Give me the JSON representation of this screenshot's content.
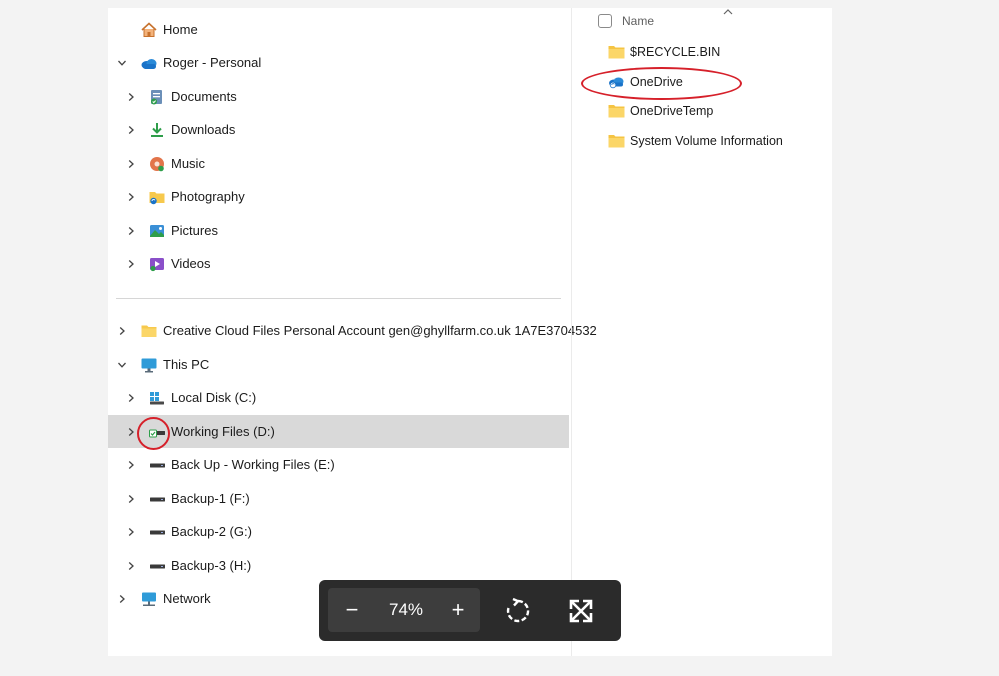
{
  "nav": {
    "home": "Home",
    "onedrive_account": "Roger - Personal",
    "onedrive_children": [
      "Documents",
      "Downloads",
      "Music",
      "Photography",
      "Pictures",
      "Videos"
    ],
    "creative_cloud": "Creative Cloud Files Personal Account gen@ghyllfarm.co.uk 1A7E3704532",
    "this_pc": "This PC",
    "drives": [
      "Local Disk (C:)",
      "Working Files (D:)",
      "Back Up - Working Files (E:)",
      "Backup-1 (F:)",
      "Backup-2 (G:)",
      "Backup-3 (H:)"
    ],
    "network": "Network",
    "selected": "Working Files (D:)"
  },
  "content": {
    "column_header": "Name",
    "files": [
      "$RECYCLE.BIN",
      "OneDrive",
      "OneDriveTemp",
      "System Volume Information"
    ],
    "highlighted": "OneDrive"
  },
  "zoom": {
    "minus": "−",
    "percent": "74%",
    "plus": "+"
  },
  "colors": {
    "highlight_ring": "#d6202a",
    "selection": "#d9d9d9",
    "folder": "#f7c94d",
    "onedrive_blue": "#1a73c8",
    "toolbar": "#2b2b2b"
  }
}
